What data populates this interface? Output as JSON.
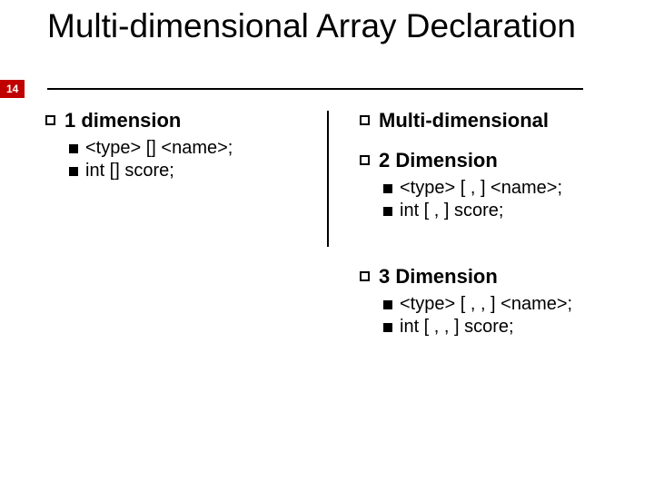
{
  "pageNumber": "14",
  "title": "Multi-dimensional Array Declaration",
  "left": {
    "heading": "1 dimension",
    "items": [
      "<type> [] <name>;",
      "int [] score;"
    ]
  },
  "right": {
    "h1": "Multi-dimensional",
    "h2": "2 Dimension",
    "h2items": [
      "<type> [ , ] <name>;",
      "int [ , ] score;"
    ],
    "h3": "3 Dimension",
    "h3items": [
      "<type> [ , , ] <name>;",
      "int [ , , ] score;"
    ]
  }
}
